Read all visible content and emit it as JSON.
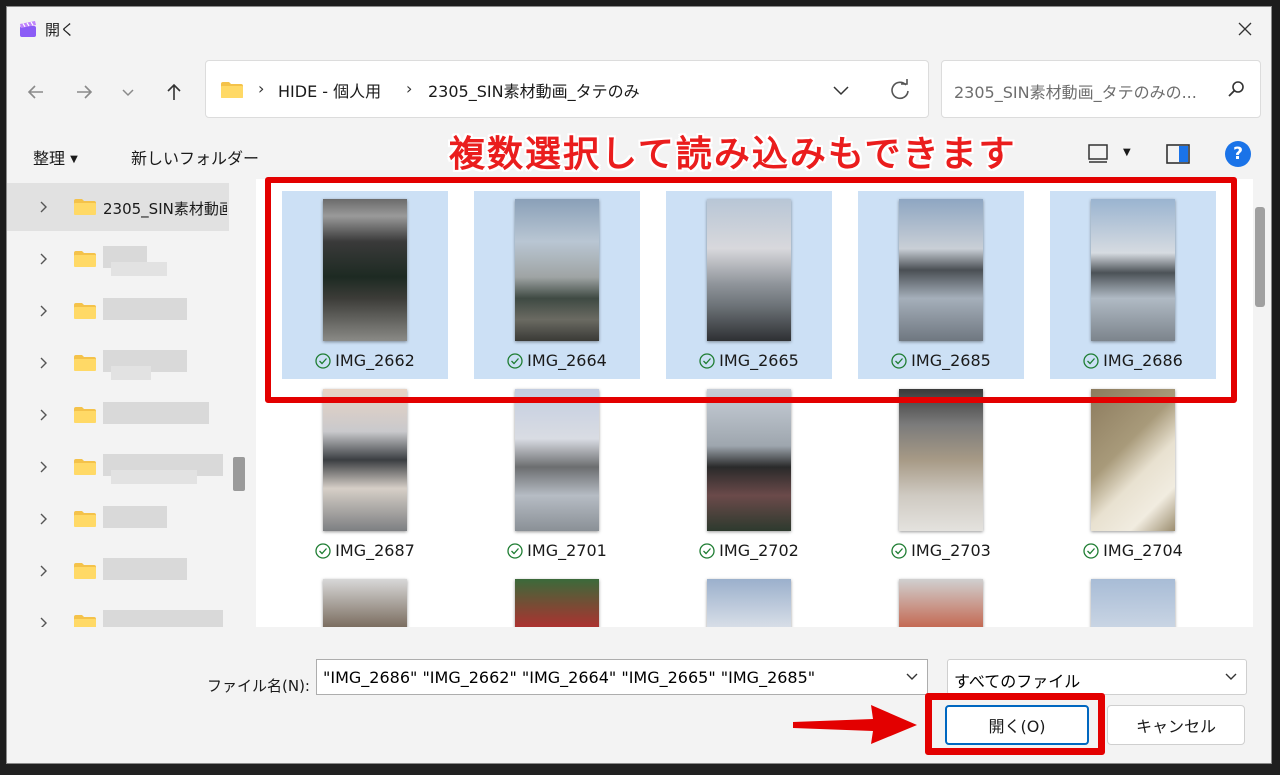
{
  "window": {
    "title": "開く"
  },
  "address": {
    "crumbs": [
      "HIDE - 個人用",
      "2305_SIN素材動画_タテのみ"
    ]
  },
  "search": {
    "placeholder": "2305_SIN素材動画_タテのみの..."
  },
  "toolbar": {
    "organize": "整理",
    "new_folder": "新しいフォルダー",
    "help": "?"
  },
  "annotation": {
    "text": "複数選択して読み込みもできます",
    "color": "#ea1d1d"
  },
  "nav": {
    "selected_folder": "2305_SIN素材動画"
  },
  "files": {
    "row1": [
      "IMG_2662",
      "IMG_2664",
      "IMG_2665",
      "IMG_2685",
      "IMG_2686"
    ],
    "row2": [
      "IMG_2687",
      "IMG_2701",
      "IMG_2702",
      "IMG_2703",
      "IMG_2704"
    ]
  },
  "footer": {
    "filename_label": "ファイル名(N):",
    "filename_value": "\"IMG_2686\" \"IMG_2662\" \"IMG_2664\" \"IMG_2665\" \"IMG_2685\"",
    "filetype_value": "すべてのファイル",
    "open_label": "開く(O)",
    "cancel_label": "キャンセル"
  },
  "colors": {
    "accent": "#0067c0",
    "highlight": "#e30000",
    "selection": "#cce0f5"
  }
}
